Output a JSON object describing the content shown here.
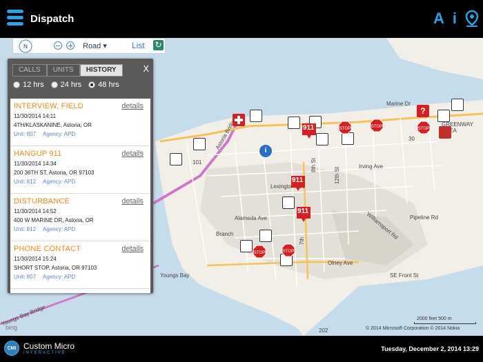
{
  "header": {
    "title": "Dispatch",
    "icon_a": "A",
    "icon_info": "i"
  },
  "toolbar": {
    "compass": "N",
    "road_label": "Road ▾",
    "list_label": "List",
    "refresh": "↻"
  },
  "panel": {
    "tabs": [
      {
        "label": "CALLS",
        "active": false
      },
      {
        "label": "UNITS",
        "active": false
      },
      {
        "label": "HISTORY",
        "active": true
      }
    ],
    "close": "X",
    "ranges": [
      {
        "label": "12 hrs",
        "selected": false
      },
      {
        "label": "24 hrs",
        "selected": false
      },
      {
        "label": "48 hrs",
        "selected": true
      }
    ],
    "calls": [
      {
        "type": "INTERVIEW, FIELD",
        "details": "details",
        "time": "11/30/2014 14:11",
        "address": "4TH/KLASKANINE, Astoria, OR",
        "unit": "Unit: 807",
        "agency": "Agency: APD"
      },
      {
        "type": "HANGUP 911",
        "details": "details",
        "time": "11/30/2014 14:34",
        "address": "200 36TH ST, Astoria, OR 97103",
        "unit": "Unit: 812",
        "agency": "Agency: APD"
      },
      {
        "type": "DISTURBANCE",
        "details": "details",
        "time": "11/30/2014 14:52",
        "address": "400 W MARINE DR, Astoria, OR",
        "unit": "Unit: 812",
        "agency": "Agency: APD"
      },
      {
        "type": "PHONE CONTACT",
        "details": "details",
        "time": "11/30/2014 15:24",
        "address": "SHORT STOP, Astoria, OR 97103",
        "unit": "Unit: 807",
        "agency": "Agency: APD"
      }
    ]
  },
  "map": {
    "labels": {
      "marine_dr": "Marine Dr",
      "irving": "Irving Ave",
      "lexington": "Lexington Ave",
      "alameda": "Alameda Ave",
      "olney": "Olney Ave",
      "pipeline": "Pipeline Rd",
      "williamsport": "Williamsport Rd",
      "se_front": "SE Front St",
      "youngs_bay": "Youngs Bay",
      "youngs_bay_bridge": "Youngs Bay Bridge",
      "astoria_bridge": "Astoria Bridge",
      "greenway": "GREENWAY AREA",
      "branch": "Branch",
      "rd_30": "30",
      "rd_101": "101",
      "rd_202": "202",
      "rd_8th": "8th St",
      "rd_12th": "12th St",
      "rd_7th": "7th"
    },
    "m911": "911",
    "bing": "bing",
    "copyright": "© 2014 Microsoft Corporation   © 2014 Nokia",
    "scale": "2000 feet          500 m"
  },
  "footer": {
    "badge": "CMI",
    "company": "Custom Micro",
    "company_sub": "INTERACTIVE",
    "datetime": "Tuesday, December 2, 2014 13:29"
  },
  "colors": {
    "accent": "#29a3e6",
    "call_type": "#f08a1c",
    "meta": "#5b86c9",
    "stop_red": "#d42020"
  }
}
